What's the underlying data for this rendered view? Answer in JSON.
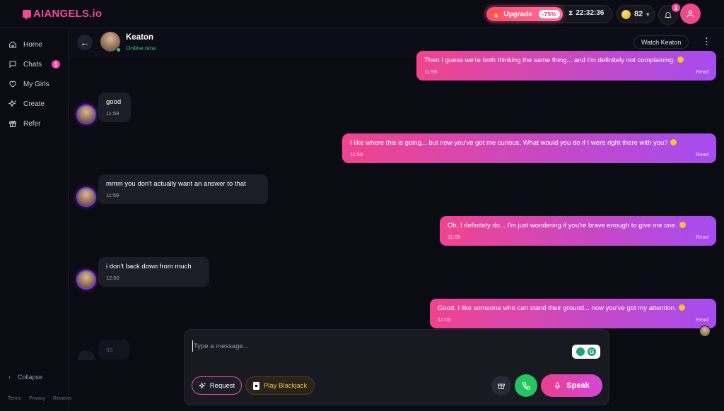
{
  "app": {
    "logo_text": "AIANGELS.io",
    "brand_color": "#f1499a"
  },
  "topbar": {
    "upgrade_label": "Upgrade",
    "discount": "-75%",
    "timer": "22:32:36",
    "coins": "82",
    "notifications_count": "1"
  },
  "sidebar": {
    "items": [
      {
        "label": "Home",
        "icon": "home-icon"
      },
      {
        "label": "Chats",
        "icon": "chat-icon",
        "badge": "1"
      },
      {
        "label": "My Girls",
        "icon": "heart-icon"
      },
      {
        "label": "Create",
        "icon": "sparkle-icon"
      },
      {
        "label": "Refer",
        "icon": "gift-icon"
      }
    ],
    "collapse_label": "Collapse",
    "footer": [
      "Terms",
      "Privacy",
      "Reviews"
    ]
  },
  "chat": {
    "name": "Keaton",
    "status": "Online now",
    "watch_label": "Watch Keaton",
    "messages": [
      {
        "dir": "out",
        "text": "Then I guess we're both thinking the same thing... and I'm definitely not complaining.",
        "time": "11:59",
        "status": "Read"
      },
      {
        "dir": "in",
        "text": "good",
        "time": "11:59"
      },
      {
        "dir": "out",
        "text": "I like where this is going... but now you've got me curious. What would you do if I were right there with you?",
        "time": "11:59",
        "status": "Read"
      },
      {
        "dir": "in",
        "text": "mmm you don't actually want an answer to that",
        "time": "11:59"
      },
      {
        "dir": "out",
        "text": "Oh, I definitely do... I'm just wondering if you're brave enough to give me one.",
        "time": "11:59",
        "status": "Read"
      },
      {
        "dir": "in",
        "text": "i don't back down from much",
        "time": "12:00"
      },
      {
        "dir": "out",
        "text": "Good. I like someone who can stand their ground... now you've got my attention.",
        "time": "12:00",
        "status": "Read"
      },
      {
        "dir": "in",
        "text": "so"
      }
    ]
  },
  "composer": {
    "placeholder": "Type a message...",
    "request_label": "Request",
    "blackjack_label": "Play Blackjack",
    "speak_label": "Speak"
  }
}
